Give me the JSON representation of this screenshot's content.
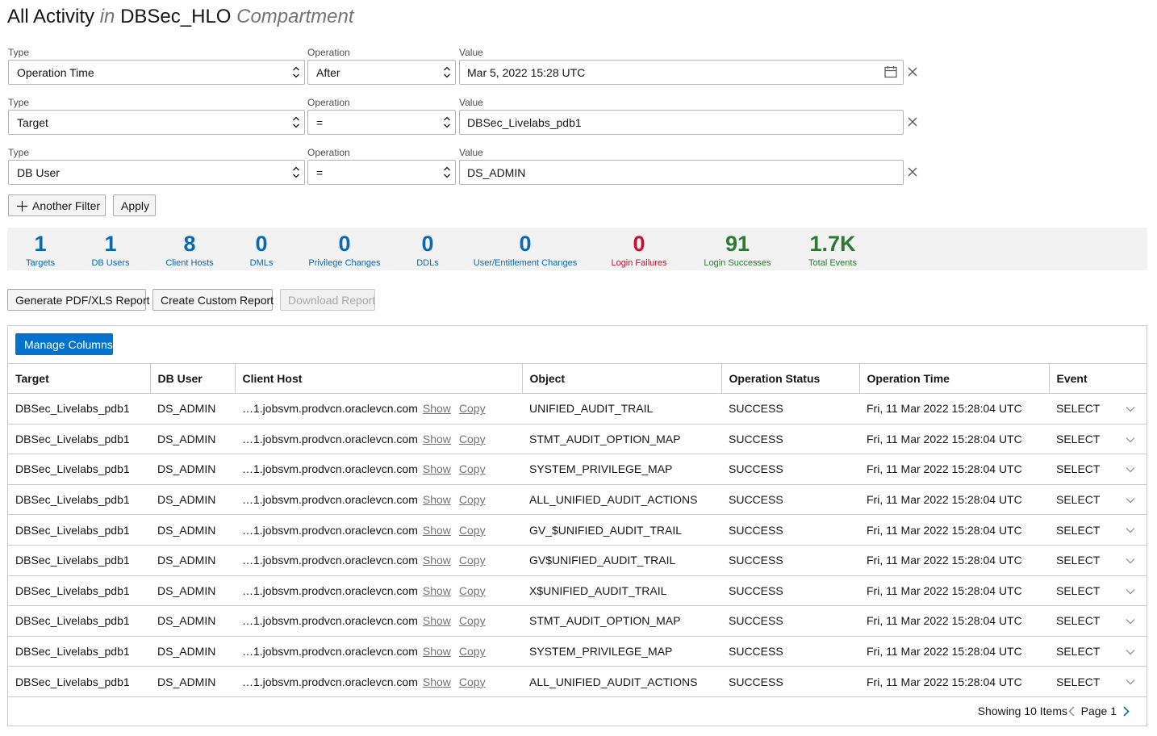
{
  "title": {
    "main": "All Activity",
    "in": "in",
    "compartment_name": "DBSec_HLO",
    "compartment_label": "Compartment"
  },
  "filters": [
    {
      "type_label": "Type",
      "type_value": "Operation Time",
      "op_label": "Operation",
      "op_value": "After",
      "value_label": "Value",
      "value": "Mar 5, 2022 15:28 UTC"
    },
    {
      "type_label": "Type",
      "type_value": "Target",
      "op_label": "Operation",
      "op_value": "=",
      "value_label": "Value",
      "value": "DBSec_Livelabs_pdb1"
    },
    {
      "type_label": "Type",
      "type_value": "DB User",
      "op_label": "Operation",
      "op_value": "=",
      "value_label": "Value",
      "value": "DS_ADMIN"
    }
  ],
  "filter_actions": {
    "another_filter": "Another Filter",
    "apply": "Apply"
  },
  "summary": [
    {
      "num": "1",
      "cap": "Targets",
      "color": "#0a6ab1"
    },
    {
      "num": "1",
      "cap": "DB Users",
      "color": "#0a6ab1"
    },
    {
      "num": "8",
      "cap": "Client Hosts",
      "color": "#0a6ab1"
    },
    {
      "num": "0",
      "cap": "DMLs",
      "color": "#0a6ab1"
    },
    {
      "num": "0",
      "cap": "Privilege Changes",
      "color": "#0a6ab1"
    },
    {
      "num": "0",
      "cap": "DDLs",
      "color": "#0a6ab1"
    },
    {
      "num": "0",
      "cap": "User/Entitlement Changes",
      "color": "#0a6ab1"
    },
    {
      "num": "0",
      "cap": "Login Failures",
      "color": "#c8102e"
    },
    {
      "num": "91",
      "cap": "Login Successes",
      "color": "#2b7a34"
    },
    {
      "num": "1.7K",
      "cap": "Total Events",
      "color": "#2b7a34"
    }
  ],
  "reports": {
    "generate": "Generate PDF/XLS Report",
    "custom": "Create Custom Report",
    "download": "Download Report"
  },
  "table": {
    "manage_columns": "Manage Columns",
    "columns": [
      "Target",
      "DB User",
      "Client Host",
      "Object",
      "Operation Status",
      "Operation Time",
      "Event"
    ],
    "show_label": "Show",
    "copy_label": "Copy",
    "rows": [
      {
        "target": "DBSec_Livelabs_pdb1",
        "user": "DS_ADMIN",
        "host": "…1.jobsvm.prodvcn.oraclevcn.com",
        "object": "UNIFIED_AUDIT_TRAIL",
        "status": "SUCCESS",
        "time": "Fri, 11 Mar 2022 15:28:04 UTC",
        "event": "SELECT"
      },
      {
        "target": "DBSec_Livelabs_pdb1",
        "user": "DS_ADMIN",
        "host": "…1.jobsvm.prodvcn.oraclevcn.com",
        "object": "STMT_AUDIT_OPTION_MAP",
        "status": "SUCCESS",
        "time": "Fri, 11 Mar 2022 15:28:04 UTC",
        "event": "SELECT"
      },
      {
        "target": "DBSec_Livelabs_pdb1",
        "user": "DS_ADMIN",
        "host": "…1.jobsvm.prodvcn.oraclevcn.com",
        "object": "SYSTEM_PRIVILEGE_MAP",
        "status": "SUCCESS",
        "time": "Fri, 11 Mar 2022 15:28:04 UTC",
        "event": "SELECT"
      },
      {
        "target": "DBSec_Livelabs_pdb1",
        "user": "DS_ADMIN",
        "host": "…1.jobsvm.prodvcn.oraclevcn.com",
        "object": "ALL_UNIFIED_AUDIT_ACTIONS",
        "status": "SUCCESS",
        "time": "Fri, 11 Mar 2022 15:28:04 UTC",
        "event": "SELECT"
      },
      {
        "target": "DBSec_Livelabs_pdb1",
        "user": "DS_ADMIN",
        "host": "…1.jobsvm.prodvcn.oraclevcn.com",
        "object": "GV_$UNIFIED_AUDIT_TRAIL",
        "status": "SUCCESS",
        "time": "Fri, 11 Mar 2022 15:28:04 UTC",
        "event": "SELECT"
      },
      {
        "target": "DBSec_Livelabs_pdb1",
        "user": "DS_ADMIN",
        "host": "…1.jobsvm.prodvcn.oraclevcn.com",
        "object": "GV$UNIFIED_AUDIT_TRAIL",
        "status": "SUCCESS",
        "time": "Fri, 11 Mar 2022 15:28:04 UTC",
        "event": "SELECT"
      },
      {
        "target": "DBSec_Livelabs_pdb1",
        "user": "DS_ADMIN",
        "host": "…1.jobsvm.prodvcn.oraclevcn.com",
        "object": "X$UNIFIED_AUDIT_TRAIL",
        "status": "SUCCESS",
        "time": "Fri, 11 Mar 2022 15:28:04 UTC",
        "event": "SELECT"
      },
      {
        "target": "DBSec_Livelabs_pdb1",
        "user": "DS_ADMIN",
        "host": "…1.jobsvm.prodvcn.oraclevcn.com",
        "object": "STMT_AUDIT_OPTION_MAP",
        "status": "SUCCESS",
        "time": "Fri, 11 Mar 2022 15:28:04 UTC",
        "event": "SELECT"
      },
      {
        "target": "DBSec_Livelabs_pdb1",
        "user": "DS_ADMIN",
        "host": "…1.jobsvm.prodvcn.oraclevcn.com",
        "object": "SYSTEM_PRIVILEGE_MAP",
        "status": "SUCCESS",
        "time": "Fri, 11 Mar 2022 15:28:04 UTC",
        "event": "SELECT"
      },
      {
        "target": "DBSec_Livelabs_pdb1",
        "user": "DS_ADMIN",
        "host": "…1.jobsvm.prodvcn.oraclevcn.com",
        "object": "ALL_UNIFIED_AUDIT_ACTIONS",
        "status": "SUCCESS",
        "time": "Fri, 11 Mar 2022 15:28:04 UTC",
        "event": "SELECT"
      }
    ]
  },
  "footer": {
    "showing": "Showing 10 Items",
    "page": "Page 1"
  }
}
